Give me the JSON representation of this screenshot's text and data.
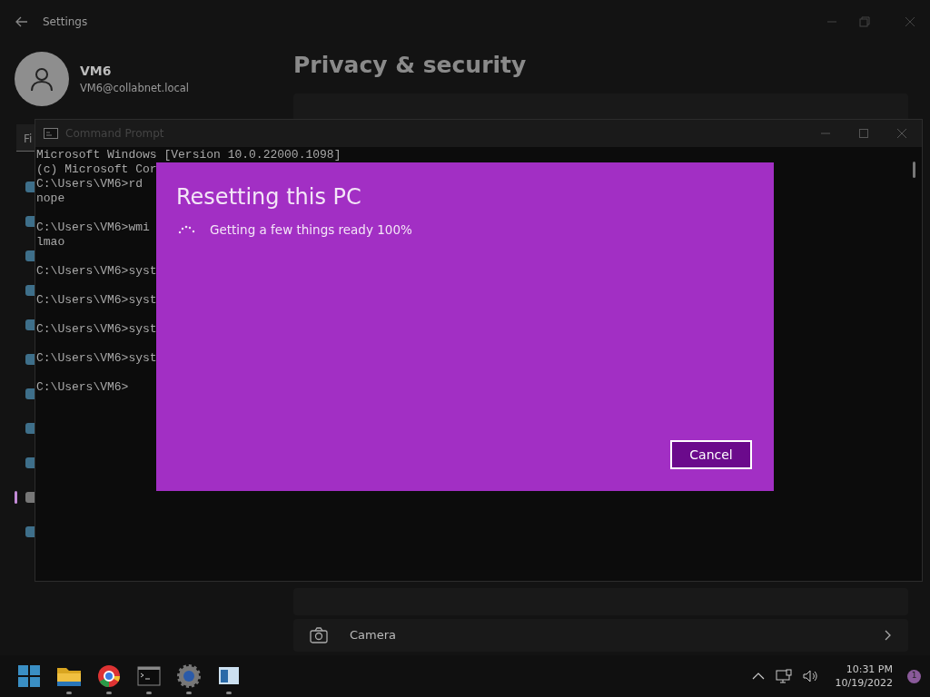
{
  "settings": {
    "title": "Settings",
    "user": {
      "name": "VM6",
      "email": "VM6@collabnet.local"
    },
    "search": {
      "value": "Fi"
    },
    "sidebar": [
      {
        "selected": false
      },
      {
        "selected": false
      },
      {
        "selected": false
      },
      {
        "selected": false
      },
      {
        "selected": false
      },
      {
        "selected": false
      },
      {
        "selected": false
      },
      {
        "selected": false
      },
      {
        "selected": false
      },
      {
        "selected": true
      },
      {
        "selected": false
      }
    ],
    "page_title": "Privacy & security",
    "rows": [
      {
        "label": "Camera"
      }
    ]
  },
  "cmd": {
    "title": "Command Prompt",
    "blocks": [
      [
        "Microsoft Windows [Version 10.0.22000.1098]",
        "(c) Microsoft Cor",
        "C:\\Users\\VM6>rd",
        "nope"
      ],
      [
        "C:\\Users\\VM6>wmi",
        "lmao"
      ],
      [
        "C:\\Users\\VM6>syst"
      ],
      [
        "C:\\Users\\VM6>syst"
      ],
      [
        "C:\\Users\\VM6>syst"
      ],
      [
        "C:\\Users\\VM6>syst"
      ],
      [
        "C:\\Users\\VM6>"
      ]
    ]
  },
  "dialog": {
    "title": "Resetting this PC",
    "status": "Getting a few things ready 100%",
    "buttons": [
      "Cancel"
    ]
  },
  "taskbar": {
    "apps": [
      {
        "kind": "start"
      },
      {
        "kind": "folder",
        "running": true
      },
      {
        "kind": "browser",
        "running": true
      },
      {
        "kind": "terminal",
        "running": true
      },
      {
        "kind": "gear",
        "running": true
      },
      {
        "kind": "window",
        "running": true
      }
    ],
    "clock": {
      "time": "10:31 PM",
      "date": "10/19/2022"
    },
    "notifications": "1"
  }
}
